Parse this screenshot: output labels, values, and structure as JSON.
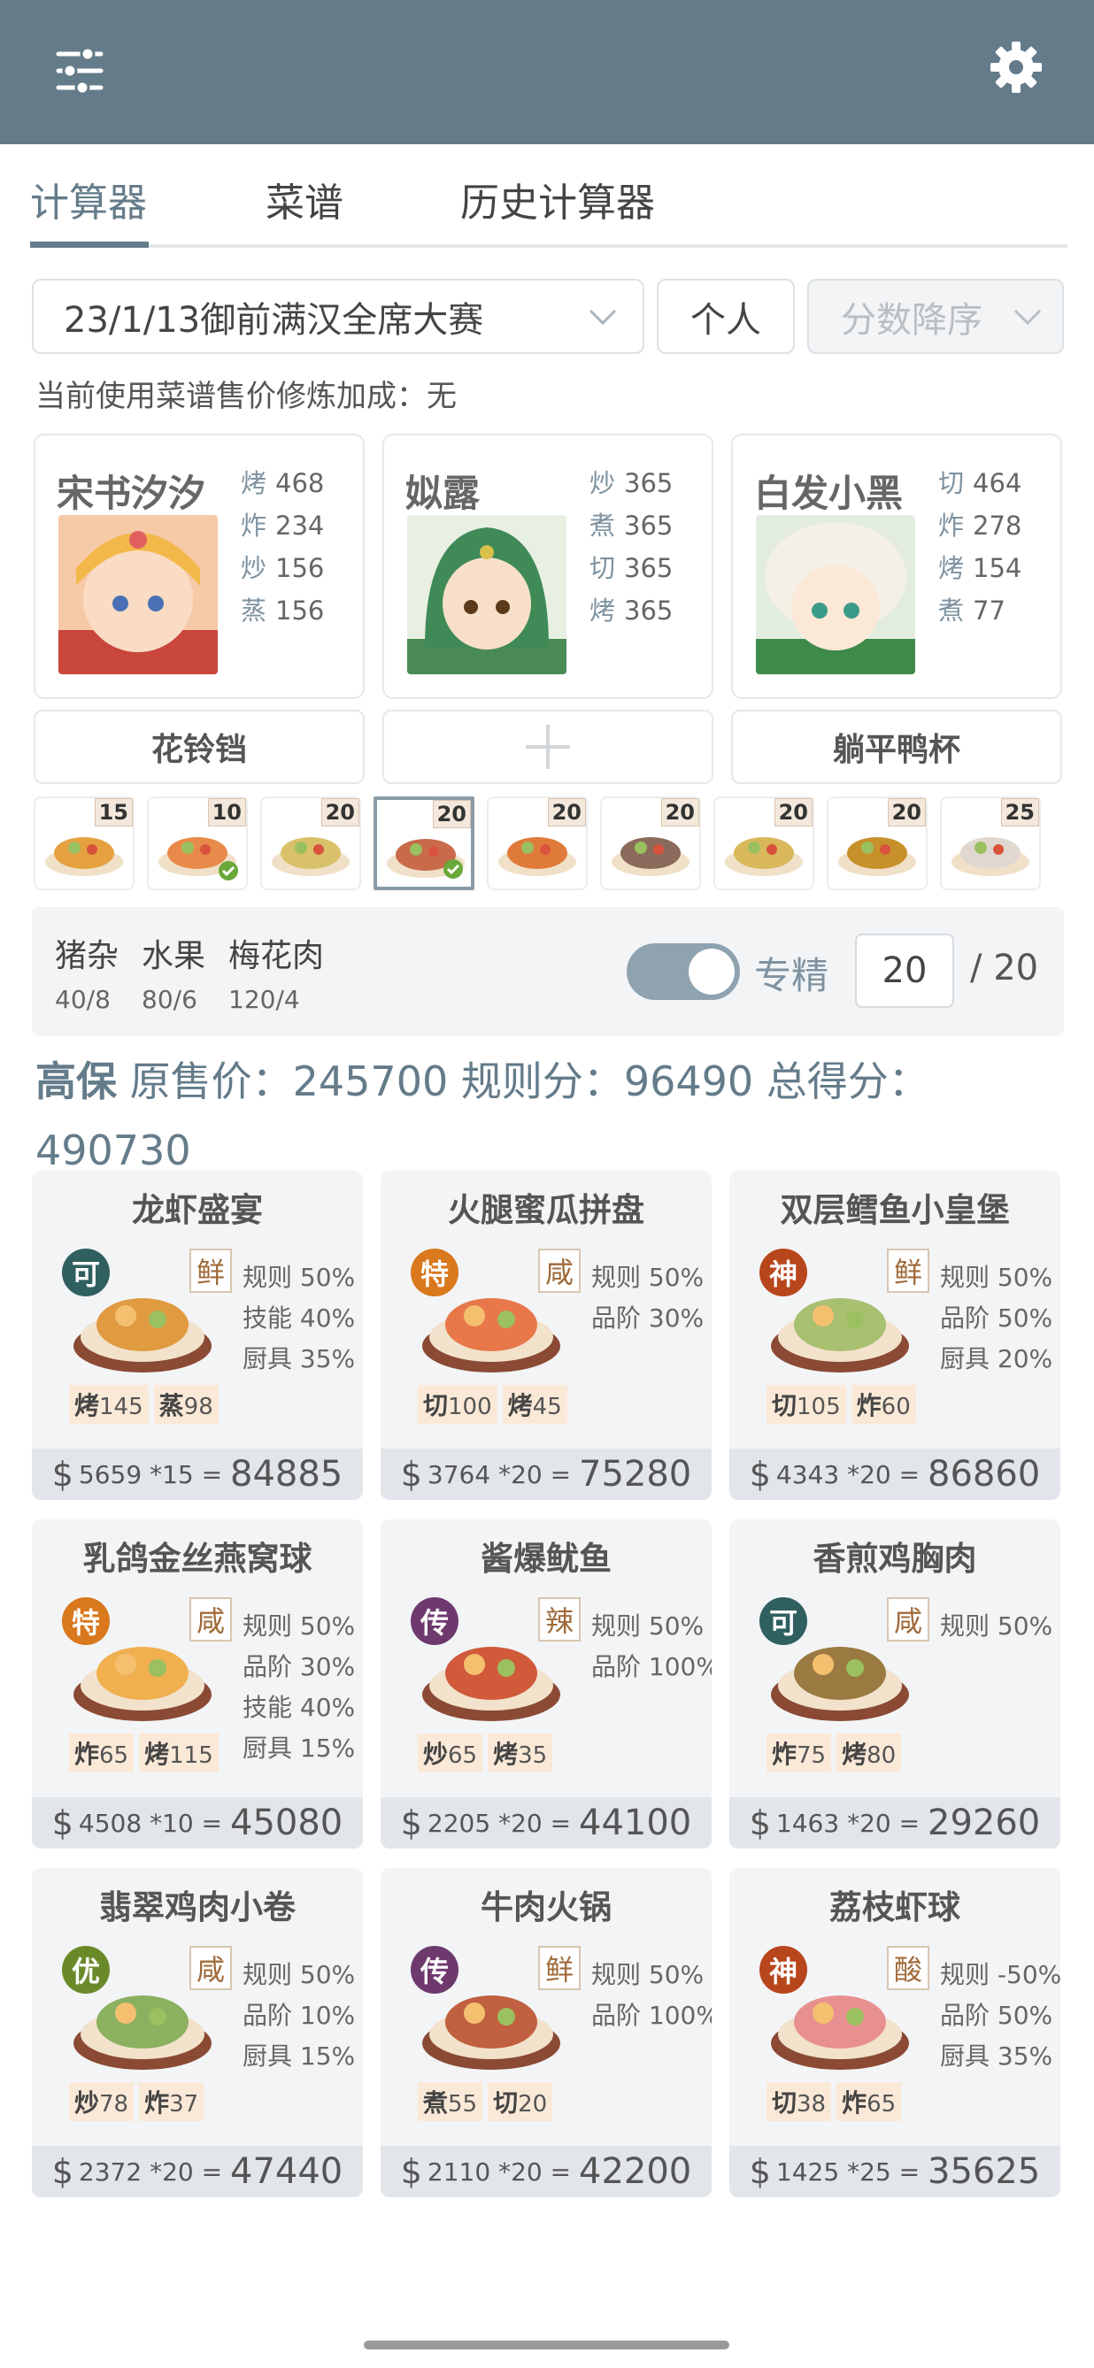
{
  "colors": {
    "topbar": "#647b8a",
    "accent": "#647b8a",
    "rarity_ke": "#2f5f5f",
    "rarity_te": "#d9781c",
    "rarity_shen": "#b8461c",
    "rarity_chuan": "#6e3a6e",
    "rarity_you": "#6a8a2a"
  },
  "topbar": {
    "left_icon": "sliders-icon",
    "right_icon": "gear-icon"
  },
  "tabs": [
    {
      "label": "计算器",
      "active": true
    },
    {
      "label": "菜谱",
      "active": false
    },
    {
      "label": "历史计算器",
      "active": false
    }
  ],
  "controls": {
    "event": "23/1/13御前满汉全席大赛",
    "mode": "个人",
    "sort": "分数降序"
  },
  "hint": "当前使用菜谱售价修炼加成：无",
  "chefs": [
    {
      "name": "宋书汐汐",
      "stats": [
        {
          "k": "烤",
          "v": "468"
        },
        {
          "k": "炸",
          "v": "234"
        },
        {
          "k": "炒",
          "v": "156"
        },
        {
          "k": "蒸",
          "v": "156"
        }
      ]
    },
    {
      "name": "姒露",
      "stats": [
        {
          "k": "炒",
          "v": "365"
        },
        {
          "k": "煮",
          "v": "365"
        },
        {
          "k": "切",
          "v": "365"
        },
        {
          "k": "烤",
          "v": "365"
        }
      ]
    },
    {
      "name": "白发小黑",
      "stats": [
        {
          "k": "切",
          "v": "464"
        },
        {
          "k": "炸",
          "v": "278"
        },
        {
          "k": "烤",
          "v": "154"
        },
        {
          "k": "煮",
          "v": "77"
        }
      ]
    }
  ],
  "equipment": [
    "花铃铛",
    "+",
    "躺平鸭杯"
  ],
  "strip": [
    {
      "count": "15"
    },
    {
      "count": "10",
      "checked": true
    },
    {
      "count": "20"
    },
    {
      "count": "20",
      "checked": true,
      "selected": true
    },
    {
      "count": "20"
    },
    {
      "count": "20"
    },
    {
      "count": "20"
    },
    {
      "count": "20"
    },
    {
      "count": "25"
    }
  ],
  "panel": {
    "ingredients": [
      {
        "name": "猪杂",
        "qty": "40/8"
      },
      {
        "name": "水果",
        "qty": "80/6"
      },
      {
        "name": "梅花肉",
        "qty": "120/4"
      }
    ],
    "toggle_on": true,
    "specialty_label": "专精",
    "quantity": "20",
    "max": "/ 20"
  },
  "summary": {
    "grade": "高保",
    "line": " 原售价：245700 规则分：96490 总得分：",
    "total": "490730"
  },
  "recipes": [
    {
      "name": "龙虾盛宴",
      "rarity": "可",
      "flavor": "鲜",
      "rules": [
        "规则 50%",
        "技能 40%",
        "厨具 35%"
      ],
      "skills": [
        {
          "k": "烤",
          "v": "145"
        },
        {
          "k": "蒸",
          "v": "98"
        }
      ],
      "price": "5659",
      "mult": "*15",
      "total": "84885"
    },
    {
      "name": "火腿蜜瓜拼盘",
      "rarity": "特",
      "flavor": "咸",
      "rules": [
        "规则 50%",
        "品阶 30%"
      ],
      "skills": [
        {
          "k": "切",
          "v": "100"
        },
        {
          "k": "烤",
          "v": "45"
        }
      ],
      "price": "3764",
      "mult": "*20",
      "total": "75280"
    },
    {
      "name": "双层鳕鱼小皇堡",
      "rarity": "神",
      "flavor": "鲜",
      "rules": [
        "规则 50%",
        "品阶 50%",
        "厨具 20%"
      ],
      "skills": [
        {
          "k": "切",
          "v": "105"
        },
        {
          "k": "炸",
          "v": "60"
        }
      ],
      "price": "4343",
      "mult": "*20",
      "total": "86860"
    },
    {
      "name": "乳鸽金丝燕窝球",
      "rarity": "特",
      "flavor": "咸",
      "rules": [
        "规则 50%",
        "品阶 30%",
        "技能 40%",
        "厨具 15%"
      ],
      "skills": [
        {
          "k": "炸",
          "v": "65"
        },
        {
          "k": "烤",
          "v": "115"
        }
      ],
      "price": "4508",
      "mult": "*10",
      "total": "45080"
    },
    {
      "name": "酱爆鱿鱼",
      "rarity": "传",
      "flavor": "辣",
      "rules": [
        "规则 50%",
        "品阶 100%"
      ],
      "skills": [
        {
          "k": "炒",
          "v": "65"
        },
        {
          "k": "烤",
          "v": "35"
        }
      ],
      "price": "2205",
      "mult": "*20",
      "total": "44100"
    },
    {
      "name": "香煎鸡胸肉",
      "rarity": "可",
      "flavor": "咸",
      "rules": [
        "规则 50%"
      ],
      "skills": [
        {
          "k": "炸",
          "v": "75"
        },
        {
          "k": "烤",
          "v": "80"
        }
      ],
      "price": "1463",
      "mult": "*20",
      "total": "29260"
    },
    {
      "name": "翡翠鸡肉小卷",
      "rarity": "优",
      "flavor": "咸",
      "rules": [
        "规则 50%",
        "品阶 10%",
        "厨具 15%"
      ],
      "skills": [
        {
          "k": "炒",
          "v": "78"
        },
        {
          "k": "炸",
          "v": "37"
        }
      ],
      "price": "2372",
      "mult": "*20",
      "total": "47440"
    },
    {
      "name": "牛肉火锅",
      "rarity": "传",
      "flavor": "鲜",
      "rules": [
        "规则 50%",
        "品阶 100%"
      ],
      "skills": [
        {
          "k": "煮",
          "v": "55"
        },
        {
          "k": "切",
          "v": "20"
        }
      ],
      "price": "2110",
      "mult": "*20",
      "total": "42200"
    },
    {
      "name": "荔枝虾球",
      "rarity": "神",
      "flavor": "酸",
      "rules": [
        "规则 -50%",
        "品阶 50%",
        "厨具 35%"
      ],
      "skills": [
        {
          "k": "切",
          "v": "38"
        },
        {
          "k": "炸",
          "v": "65"
        }
      ],
      "price": "1425",
      "mult": "*25",
      "total": "35625"
    }
  ]
}
